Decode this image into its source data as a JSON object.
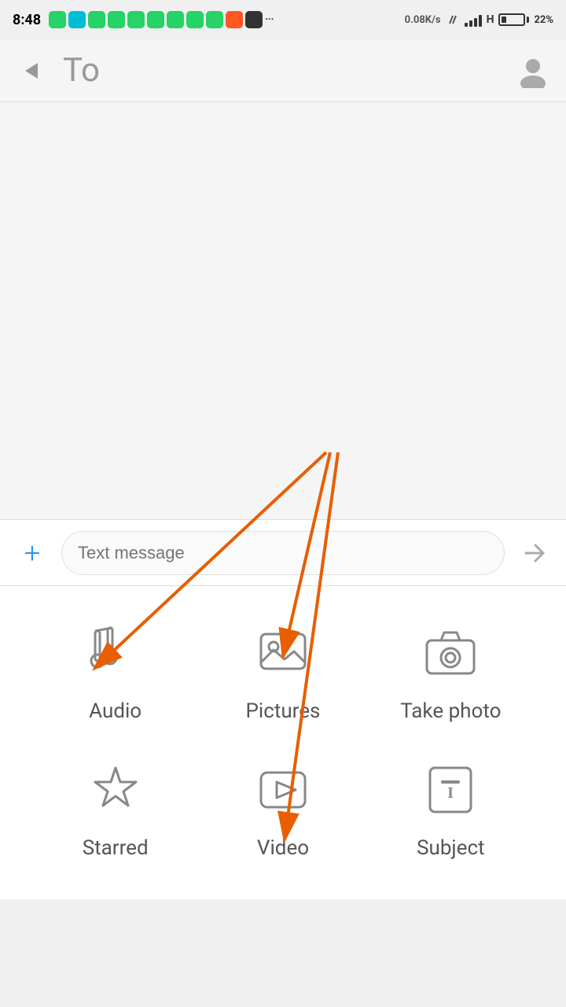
{
  "status_bar": {
    "time": "8:48",
    "network": "0.08K/s",
    "signal": "H",
    "battery": "22%"
  },
  "header": {
    "back_label": "",
    "to_label": "To",
    "contact_icon": "person-icon"
  },
  "input_bar": {
    "plus_label": "+",
    "placeholder": "Text message",
    "send_icon": "send-icon"
  },
  "attach_items": [
    {
      "id": "audio",
      "label": "Audio",
      "icon": "music-icon"
    },
    {
      "id": "pictures",
      "label": "Pictures",
      "icon": "image-icon"
    },
    {
      "id": "take-photo",
      "label": "Take photo",
      "icon": "camera-icon"
    },
    {
      "id": "starred",
      "label": "Starred",
      "icon": "star-icon"
    },
    {
      "id": "video",
      "label": "Video",
      "icon": "video-icon"
    },
    {
      "id": "subject",
      "label": "Subject",
      "icon": "subject-icon"
    }
  ]
}
